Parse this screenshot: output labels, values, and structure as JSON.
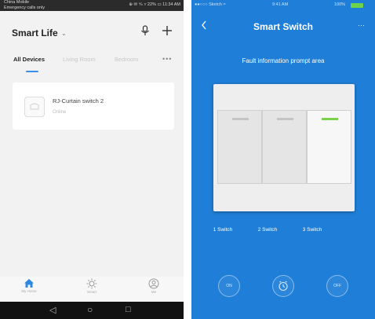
{
  "left": {
    "status_bar": {
      "carrier": "China Mobile\nEmergency calls only",
      "right": "⊕ ✉ ⁴⁄ₙ ▿ 22% ▭ 11:34 AM"
    },
    "header": {
      "title": "Smart Life",
      "caret": "⌄",
      "voice_icon": "voice-assistant-icon",
      "add_icon": "plus-icon"
    },
    "tabs": [
      {
        "label": "All Devices",
        "active": true
      },
      {
        "label": "Living Room",
        "active": false
      },
      {
        "label": "Bedroom",
        "active": false
      }
    ],
    "more_tabs": "•••",
    "device": {
      "name": "RJ-Curtain switch 2",
      "status": "Online"
    },
    "bottom_nav": [
      {
        "label": "My Home",
        "icon": "home-icon"
      },
      {
        "label": "Smart",
        "icon": "smart-sun-icon"
      },
      {
        "label": "Me",
        "icon": "profile-icon"
      }
    ],
    "system_nav": {
      "back": "◁",
      "home": "○",
      "recents": "□"
    }
  },
  "right": {
    "status_bar": {
      "carrier": "●●○○○ Sketch ≈",
      "time": "9:41 AM",
      "battery_text": "100%"
    },
    "title": "Smart Switch",
    "more": "···",
    "fault_text": "Fault information prompt area",
    "switches": [
      {
        "label": "1 Switch",
        "on": false
      },
      {
        "label": "2 Switch",
        "on": false
      },
      {
        "label": "3 Switch",
        "on": true
      }
    ],
    "controls": {
      "on_label": "ON",
      "timer_icon": "timer-icon",
      "off_label": "OFF"
    },
    "colors": {
      "background": "#1f7fd8",
      "switch_on_indicator": "#7bd14a"
    }
  }
}
